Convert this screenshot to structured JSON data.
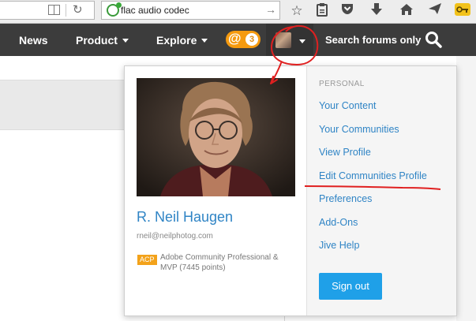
{
  "browser": {
    "search_query": "flac audio codec",
    "toolbar_icons": [
      "star-icon",
      "clipboard-icon",
      "pocket-icon",
      "download-icon",
      "home-icon",
      "send-icon",
      "key-icon"
    ]
  },
  "nav": {
    "news": "News",
    "product": "Product",
    "explore": "Explore",
    "notification_count": "3",
    "search_label": "Search forums only"
  },
  "profile": {
    "name": "R. Neil Haugen",
    "email": "rneil@neilphotog.com",
    "badge": "ACP",
    "badge_desc": "Adobe Community Professional & MVP (7445 points)"
  },
  "menu": {
    "heading": "PERSONAL",
    "items": [
      "Your Content",
      "Your Communities",
      "View Profile",
      "Edit Communities Profile",
      "Preferences",
      "Add-Ons",
      "Jive Help"
    ],
    "signout": "Sign out"
  },
  "colors": {
    "nav_bg": "#3c3c3c",
    "link": "#2f84c5",
    "notification": "#f59a0f",
    "signout": "#1fa0e8",
    "annotation": "#e02020"
  }
}
